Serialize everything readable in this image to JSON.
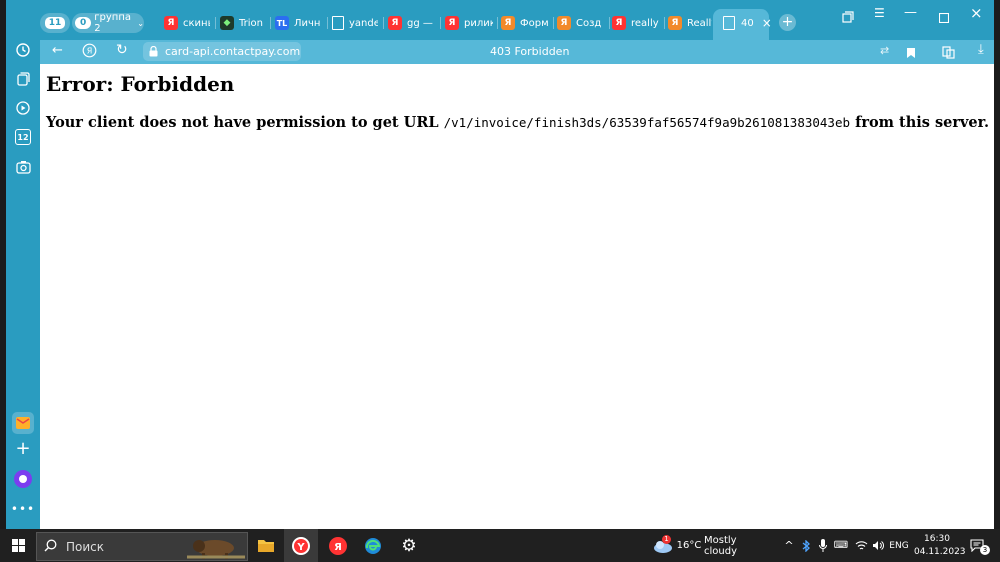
{
  "browser": {
    "tab_group_count": "11",
    "tab_group": {
      "count": "0",
      "label": "группа 2"
    },
    "tabs": [
      {
        "label": "скинь",
        "fav": "Я"
      },
      {
        "label": "Trion",
        "fav": "◆"
      },
      {
        "label": "Личн",
        "fav": "TL"
      },
      {
        "label": "yande",
        "fav": ""
      },
      {
        "label": "gg —",
        "fav": "Я"
      },
      {
        "label": "рилик",
        "fav": "Я"
      },
      {
        "label": "Форм",
        "fav": "Я"
      },
      {
        "label": "Созд",
        "fav": "Я"
      },
      {
        "label": "really",
        "fav": "Я"
      },
      {
        "label": "Really",
        "fav": "Я"
      }
    ],
    "active_tab": {
      "label": "40"
    },
    "address": "card-api.contactpay.com",
    "page_title": "403 Forbidden",
    "sidebar_badge": "12"
  },
  "page": {
    "heading": "Error: Forbidden",
    "message_before": "Your client does not have permission to get URL",
    "url_path": "/v1/invoice/finish3ds/63539faf56574f9a9b261081383043eb",
    "message_after": "from this server."
  },
  "taskbar": {
    "search_placeholder": "Поиск",
    "weather": {
      "temp": "16°C",
      "condition": "Mostly cloudy",
      "alert_count": "1"
    },
    "language": "ENG",
    "time": "16:30",
    "date": "04.11.2023",
    "notification_count": "3"
  },
  "colors": {
    "accent": "#2a9cc0",
    "toolbar": "#56b8d8",
    "taskbar": "#202020"
  }
}
